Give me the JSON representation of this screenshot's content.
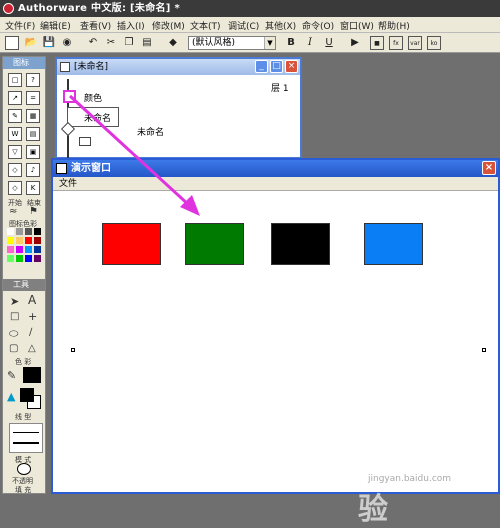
{
  "app": {
    "title": "Authorware 中文版: [未命名] *"
  },
  "menu": [
    "文件(F)",
    "编辑(E)",
    "查看(V)",
    "插入(I)",
    "修改(M)",
    "文本(T)",
    "调试(C)",
    "其他(X)",
    "命令(O)",
    "窗口(W)",
    "帮助(H)"
  ],
  "toolbar": {
    "style_value": "(默认风格)",
    "bold": "B",
    "italic": "I",
    "underline": "U"
  },
  "icon_palette": {
    "title": "图标",
    "start_label": "开始",
    "end_label": "结束",
    "icon_color_label": "图标色彩",
    "tools_title": "工具",
    "color_label": "色 彩",
    "line_label": "线 型",
    "mode_label": "模 式",
    "mode_value": "不透明",
    "fill_label": "填 充",
    "text_tool": "A"
  },
  "design_window": {
    "title": "[未命名]",
    "level": "层 1",
    "icon_label": "颜色",
    "map_label": "未命名",
    "map_label2": "未命名"
  },
  "presentation_window": {
    "title": "演示窗口",
    "menu_file": "文件"
  },
  "colors": {
    "red": "#ff0000",
    "green": "#007a00",
    "black": "#000000",
    "blue": "#0a7ff5",
    "arrow": "#e033e0"
  },
  "watermark": {
    "brand": "Baidu经验",
    "url": "jingyan.baidu.com"
  }
}
